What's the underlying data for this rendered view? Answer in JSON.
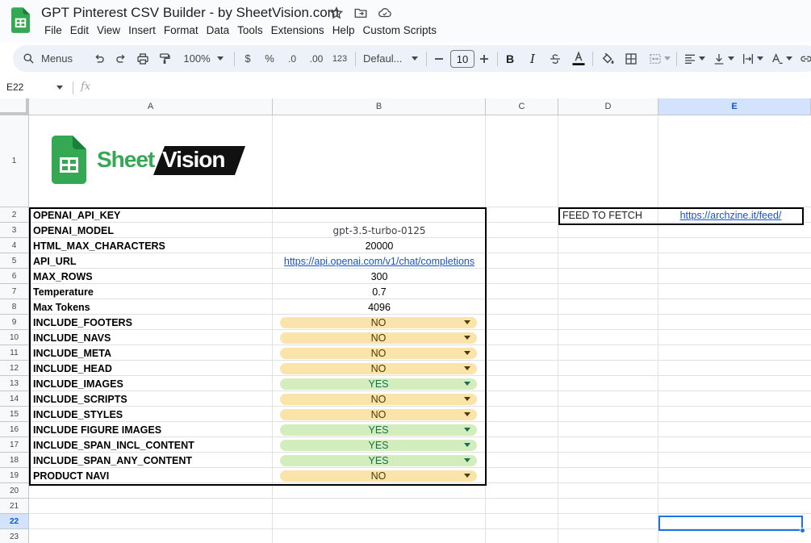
{
  "doc": {
    "title": "GPT Pinterest CSV Builder - by SheetVision.com"
  },
  "menu": [
    "File",
    "Edit",
    "View",
    "Insert",
    "Format",
    "Data",
    "Tools",
    "Extensions",
    "Help",
    "Custom Scripts"
  ],
  "toolbar": {
    "search_label": "Menus",
    "zoom": "100%",
    "currency": "$",
    "percent": "%",
    "dec_decrease": ".0",
    "dec_increase": ".00",
    "number_format": "123",
    "font": "Defaul...",
    "font_size": "10"
  },
  "formula_bar": {
    "cell_ref": "E22",
    "fx": "fx"
  },
  "columns": [
    "A",
    "B",
    "C",
    "D",
    "E"
  ],
  "rows": [
    "1",
    "2",
    "3",
    "4",
    "5",
    "6",
    "7",
    "8",
    "9",
    "10",
    "11",
    "12",
    "13",
    "14",
    "15",
    "16",
    "17",
    "18",
    "19",
    "20",
    "21",
    "22",
    "23"
  ],
  "logo": {
    "text_sheet": "Sheet",
    "text_vision": "Vision",
    "accent": "#34a853"
  },
  "settings": [
    {
      "key": "OPENAI_API_KEY",
      "value": ""
    },
    {
      "key": "OPENAI_MODEL",
      "value": "gpt-3.5-turbo-0125"
    },
    {
      "key": "HTML_MAX_CHARACTERS",
      "value": "20000"
    },
    {
      "key": "API_URL",
      "value": "https://api.openai.com/v1/chat/completions"
    },
    {
      "key": "MAX_ROWS",
      "value": "300"
    },
    {
      "key": "Temperature",
      "value": "0.7"
    },
    {
      "key": "Max Tokens",
      "value": "4096"
    },
    {
      "key": "INCLUDE_FOOTERS",
      "value": "NO"
    },
    {
      "key": "INCLUDE_NAVS",
      "value": "NO"
    },
    {
      "key": "INCLUDE_META",
      "value": "NO"
    },
    {
      "key": "INCLUDE_HEAD",
      "value": "NO"
    },
    {
      "key": "INCLUDE_IMAGES",
      "value": "YES"
    },
    {
      "key": "INCLUDE_SCRIPTS",
      "value": "NO"
    },
    {
      "key": "INCLUDE_STYLES",
      "value": "NO"
    },
    {
      "key": "INCLUDE FIGURE IMAGES",
      "value": "YES"
    },
    {
      "key": "INCLUDE_SPAN_INCL_CONTENT",
      "value": "YES"
    },
    {
      "key": "INCLUDE_SPAN_ANY_CONTENT",
      "value": "YES"
    },
    {
      "key": "PRODUCT NAVI",
      "value": "NO"
    }
  ],
  "feed": {
    "label": "FEED TO FETCH",
    "url": "https://archzine.it/feed/"
  },
  "colors": {
    "chip_no_bg": "#fbe4a9",
    "chip_yes_bg": "#d4edbc",
    "selection": "#1a73e8",
    "link": "#1155cc"
  }
}
